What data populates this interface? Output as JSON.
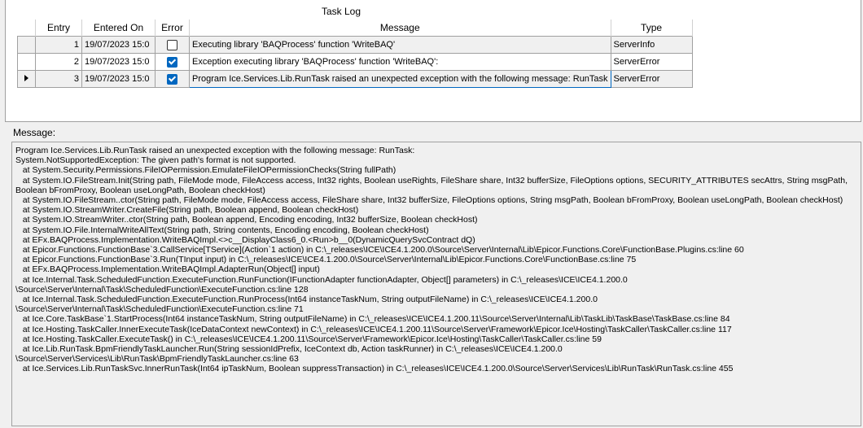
{
  "task_log": {
    "title": "Task Log",
    "columns": [
      "Entry",
      "Entered On",
      "Error",
      "Message",
      "Type"
    ],
    "rows": [
      {
        "entry": "1",
        "entered_on": "19/07/2023 15:0",
        "error": false,
        "message": "Executing library 'BAQProcess' function 'WriteBAQ'",
        "type": "ServerInfo"
      },
      {
        "entry": "2",
        "entered_on": "19/07/2023 15:0",
        "error": true,
        "message": "Exception executing library 'BAQProcess' function 'WriteBAQ':",
        "type": "ServerError"
      },
      {
        "entry": "3",
        "entered_on": "19/07/2023 15:0",
        "error": true,
        "message": "Program Ice.Services.Lib.RunTask raised an unexpected exception with the following message: RunTask",
        "type": "ServerError"
      }
    ]
  },
  "message_panel": {
    "label": "Message:",
    "text": "Program Ice.Services.Lib.RunTask raised an unexpected exception with the following message: RunTask:\nSystem.NotSupportedException: The given path's format is not supported.\n   at System.Security.Permissions.FileIOPermission.EmulateFileIOPermissionChecks(String fullPath)\n   at System.IO.FileStream.Init(String path, FileMode mode, FileAccess access, Int32 rights, Boolean useRights, FileShare share, Int32 bufferSize, FileOptions options, SECURITY_ATTRIBUTES secAttrs, String msgPath, Boolean bFromProxy, Boolean useLongPath, Boolean checkHost)\n   at System.IO.FileStream..ctor(String path, FileMode mode, FileAccess access, FileShare share, Int32 bufferSize, FileOptions options, String msgPath, Boolean bFromProxy, Boolean useLongPath, Boolean checkHost)\n   at System.IO.StreamWriter.CreateFile(String path, Boolean append, Boolean checkHost)\n   at System.IO.StreamWriter..ctor(String path, Boolean append, Encoding encoding, Int32 bufferSize, Boolean checkHost)\n   at System.IO.File.InternalWriteAllText(String path, String contents, Encoding encoding, Boolean checkHost)\n   at EFx.BAQProcess.Implementation.WriteBAQImpl.<>c__DisplayClass6_0.<Run>b__0(DynamicQuerySvcContract dQ)\n   at Epicor.Functions.FunctionBase`3.CallService[TService](Action`1 action) in C:\\_releases\\ICE\\ICE4.1.200.0\\Source\\Server\\Internal\\Lib\\Epicor.Functions.Core\\FunctionBase.Plugins.cs:line 60\n   at Epicor.Functions.FunctionBase`3.Run(TInput input) in C:\\_releases\\ICE\\ICE4.1.200.0\\Source\\Server\\Internal\\Lib\\Epicor.Functions.Core\\FunctionBase.cs:line 75\n   at EFx.BAQProcess.Implementation.WriteBAQImpl.AdapterRun(Object[] input)\n   at Ice.Internal.Task.ScheduledFunction.ExecuteFunction.RunFunction(IFunctionAdapter functionAdapter, Object[] parameters) in C:\\_releases\\ICE\\ICE4.1.200.0\n\\Source\\Server\\Internal\\Task\\ScheduledFunction\\ExecuteFunction.cs:line 128\n   at Ice.Internal.Task.ScheduledFunction.ExecuteFunction.RunProcess(Int64 instanceTaskNum, String outputFileName) in C:\\_releases\\ICE\\ICE4.1.200.0\n\\Source\\Server\\Internal\\Task\\ScheduledFunction\\ExecuteFunction.cs:line 71\n   at Ice.Core.TaskBase`1.StartProcess(Int64 instanceTaskNum, String outputFileName) in C:\\_releases\\ICE\\ICE4.1.200.11\\Source\\Server\\Internal\\Lib\\TaskLib\\TaskBase\\TaskBase.cs:line 84\n   at Ice.Hosting.TaskCaller.InnerExecuteTask(IceDataContext newContext) in C:\\_releases\\ICE\\ICE4.1.200.11\\Source\\Server\\Framework\\Epicor.Ice\\Hosting\\TaskCaller\\TaskCaller.cs:line 117\n   at Ice.Hosting.TaskCaller.ExecuteTask() in C:\\_releases\\ICE\\ICE4.1.200.11\\Source\\Server\\Framework\\Epicor.Ice\\Hosting\\TaskCaller\\TaskCaller.cs:line 59\n   at Ice.Lib.RunTask.BpmFriendlyTaskLauncher.Run(String sessionIdPrefix, IceContext db, Action taskRunner) in C:\\_releases\\ICE\\ICE4.1.200.0\n\\Source\\Server\\Services\\Lib\\RunTask\\BpmFriendlyTaskLauncher.cs:line 63\n   at Ice.Services.Lib.RunTaskSvc.InnerRunTask(Int64 ipTaskNum, Boolean suppressTransaction) in C:\\_releases\\ICE\\ICE4.1.200.0\\Source\\Server\\Services\\Lib\\RunTask\\RunTask.cs:line 455"
  }
}
